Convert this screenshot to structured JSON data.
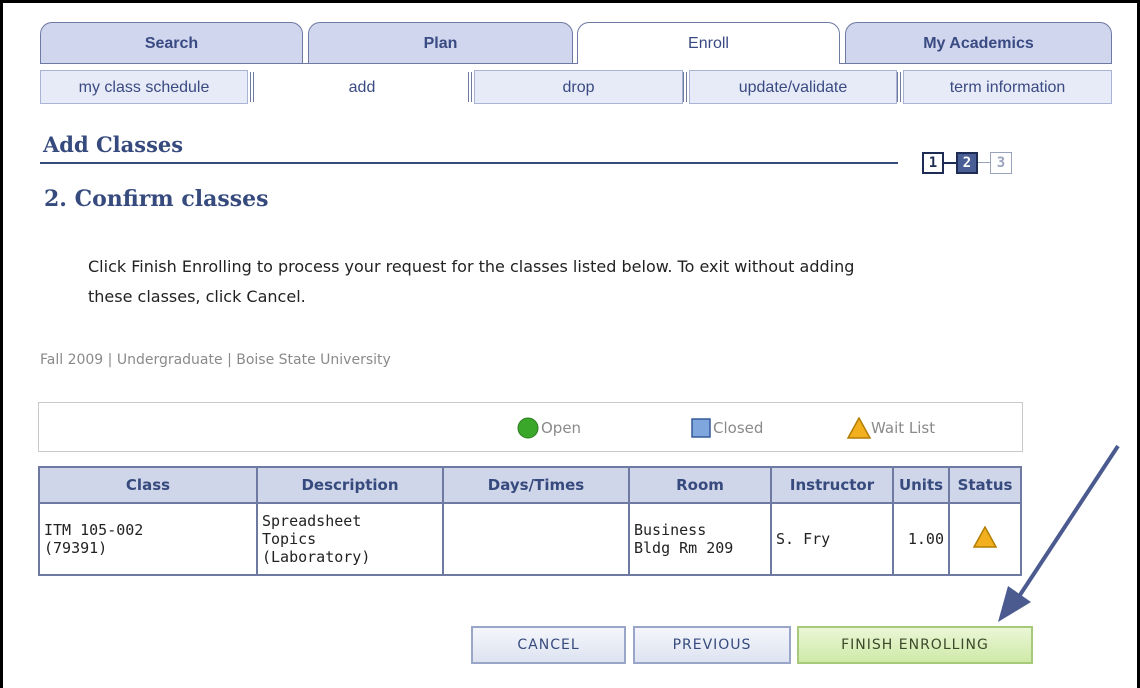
{
  "tabs": [
    "Search",
    "Plan",
    "Enroll",
    "My Academics"
  ],
  "active_tab": "Enroll",
  "subtabs": [
    "my class schedule",
    "add",
    "drop",
    "update/validate",
    "term information"
  ],
  "active_subtab": "add",
  "page": {
    "section_title": "Add Classes",
    "step_title": "2. Confirm classes",
    "instructions": "Click Finish Enrolling to process your request for the classes listed below. To exit without adding these classes, click Cancel.",
    "term_info": "Fall 2009 | Undergraduate | Boise State University"
  },
  "steps": [
    "1",
    "2",
    "3"
  ],
  "current_step": 2,
  "legend": {
    "open": "Open",
    "closed": "Closed",
    "wait_list": "Wait List",
    "colors": {
      "open": "#3aa62a",
      "closed": "#7fa6dd",
      "wait_list": "#f2b01e"
    }
  },
  "table": {
    "headers": [
      "Class",
      "Description",
      "Days/Times",
      "Room",
      "Instructor",
      "Units",
      "Status"
    ],
    "rows": [
      {
        "class_line1": "ITM 105-002",
        "class_line2": "(79391)",
        "desc_line1": "Spreadsheet",
        "desc_line2": "Topics",
        "desc_line3": "(Laboratory)",
        "days_times": "",
        "room_line1": "Business",
        "room_line2": "Bldg Rm 209",
        "instructor": "S. Fry",
        "units": "1.00",
        "status_icon": "wait-list-triangle-icon"
      }
    ]
  },
  "buttons": {
    "cancel": "CANCEL",
    "previous": "PREVIOUS",
    "finish": "FINISH ENROLLING"
  },
  "annotation_color": "#4b5a8f"
}
